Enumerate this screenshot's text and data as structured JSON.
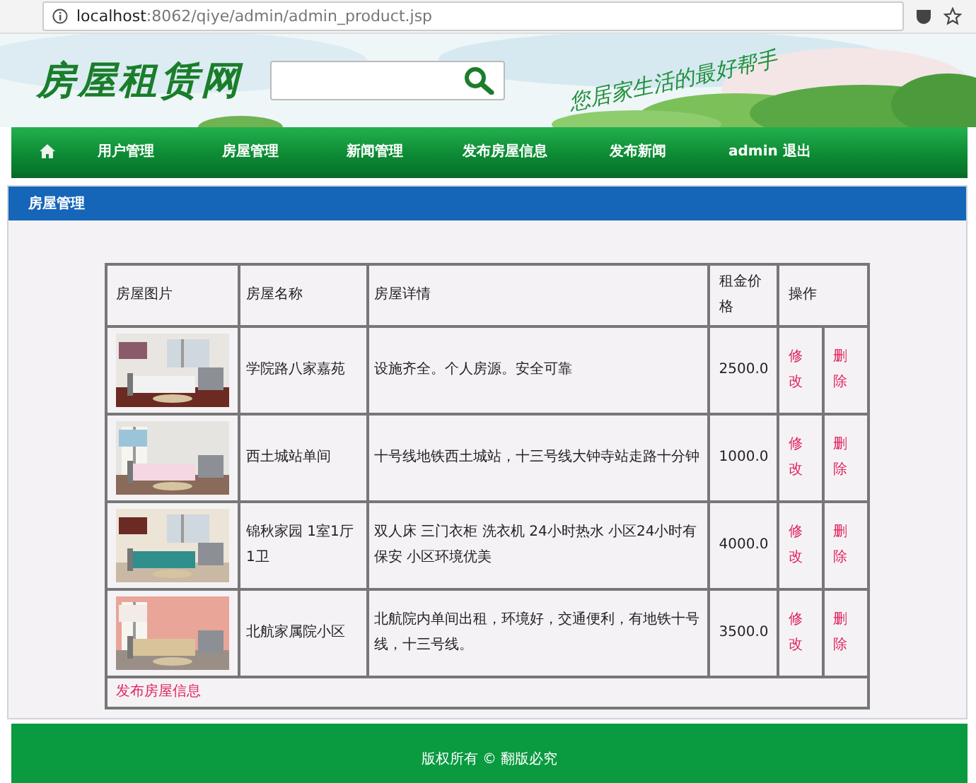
{
  "browser": {
    "url": "**localhost**:8062/qiye/admin/admin_product.jsp"
  },
  "header": {
    "logo": "房屋租赁网",
    "slogan": "您居家生活的最好帮手"
  },
  "nav": {
    "items": [
      {
        "label": "用户管理"
      },
      {
        "label": "房屋管理"
      },
      {
        "label": "新闻管理"
      },
      {
        "label": "发布房屋信息"
      },
      {
        "label": "发布新闻"
      },
      {
        "label": "admin 退出"
      }
    ]
  },
  "panel": {
    "title": "房屋管理"
  },
  "table": {
    "columns": [
      "房屋图片",
      "房屋名称",
      "房屋详情",
      "租金价格",
      "操作"
    ],
    "rows": [
      {
        "name": "学院路八家嘉苑",
        "detail": "设施齐全。个人房源。安全可靠",
        "price": "2500.0",
        "edit": "修改",
        "delete": "删除"
      },
      {
        "name": "西土城站单间",
        "detail": "十号线地铁西土城站，十三号线大钟寺站走路十分钟",
        "price": "1000.0",
        "edit": "修改",
        "delete": "删除"
      },
      {
        "name": "锦秋家园 1室1厅1卫",
        "detail": "双人床 三门衣柜 洗衣机 24小时热水 小区24小时有保安 小区环境优美",
        "price": "4000.0",
        "edit": "修改",
        "delete": "删除"
      },
      {
        "name": "北航家属院小区",
        "detail": "北航院内单间出租，环境好，交通便利，有地铁十号线，十三号线。",
        "price": "3500.0",
        "edit": "修改",
        "delete": "删除"
      }
    ],
    "footer_link": "发布房屋信息"
  },
  "footer": {
    "text": "版权所有 © 翻版必究"
  }
}
